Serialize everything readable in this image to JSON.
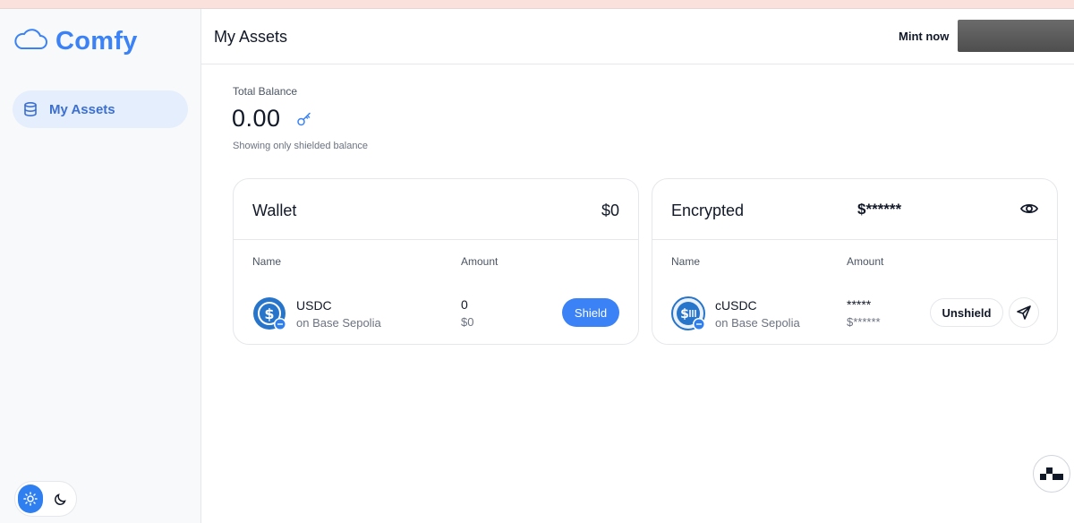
{
  "app": {
    "name": "Comfy",
    "brand_color": "#3b82f6"
  },
  "sidebar": {
    "items": [
      {
        "label": "My Assets",
        "icon": "database-icon",
        "active": true
      }
    ],
    "theme": {
      "options": [
        "light",
        "dark"
      ],
      "selected": "light"
    }
  },
  "header": {
    "title": "My Assets",
    "mint_label": "Mint now"
  },
  "balance": {
    "label": "Total Balance",
    "value": "0.00",
    "note": "Showing only shielded balance"
  },
  "wallet_card": {
    "title": "Wallet",
    "total": "$0",
    "columns": [
      "Name",
      "Amount"
    ],
    "rows": [
      {
        "token": "USDC",
        "chain": "on Base Sepolia",
        "amount": "0",
        "value": "$0",
        "action": "Shield"
      }
    ]
  },
  "encrypted_card": {
    "title": "Encrypted",
    "total": "$******",
    "columns": [
      "Name",
      "Amount"
    ],
    "rows": [
      {
        "token": "cUSDC",
        "chain": "on Base Sepolia",
        "amount": "*****",
        "value": "$******",
        "action": "Unshield",
        "send_icon": "send-icon"
      }
    ]
  }
}
